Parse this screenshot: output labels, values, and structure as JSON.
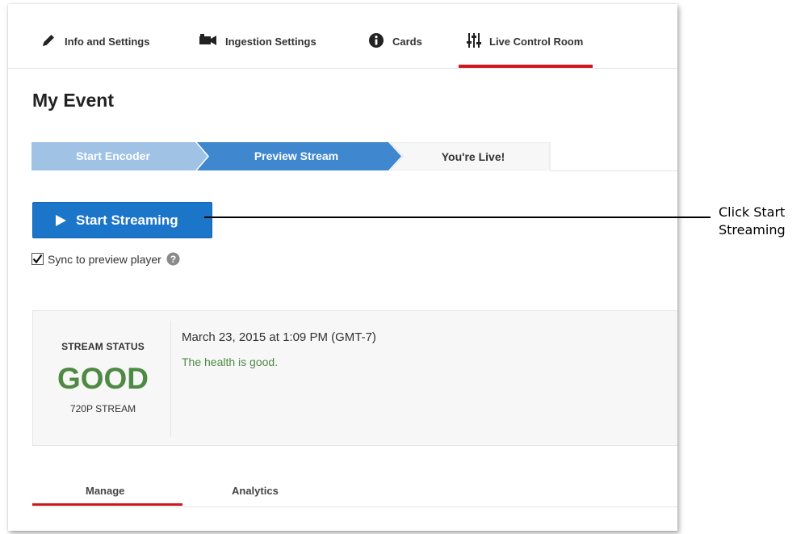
{
  "top_tabs": [
    {
      "label": "Info and Settings",
      "icon": "pencil-icon"
    },
    {
      "label": "Ingestion Settings",
      "icon": "video-camera-icon"
    },
    {
      "label": "Cards",
      "icon": "info-icon"
    },
    {
      "label": "Live Control Room",
      "icon": "sliders-icon",
      "active": true
    }
  ],
  "event_title": "My Event",
  "steps": [
    {
      "label": "Start Encoder",
      "state": "done"
    },
    {
      "label": "Preview Stream",
      "state": "current"
    },
    {
      "label": "You're Live!",
      "state": "pending"
    }
  ],
  "start_button": {
    "label": "Start Streaming",
    "icon": "play-icon"
  },
  "sync": {
    "label": "Sync to preview player",
    "checked": true,
    "help_icon": "help-icon"
  },
  "status": {
    "label": "STREAM STATUS",
    "value": "GOOD",
    "resolution": "720P STREAM",
    "date": "March 23, 2015 at 1:09 PM (GMT-7)",
    "health": "The health is good."
  },
  "bottom_tabs": [
    {
      "label": "Manage",
      "active": true
    },
    {
      "label": "Analytics"
    }
  ],
  "callout": {
    "line1": "Click Start",
    "line2": "Streaming"
  },
  "colors": {
    "accent_red": "#cc181e",
    "button_blue": "#1b75c9",
    "step_done": "#9fc2e5",
    "step_current": "#3f87ce",
    "good_green": "#4e8a43"
  }
}
